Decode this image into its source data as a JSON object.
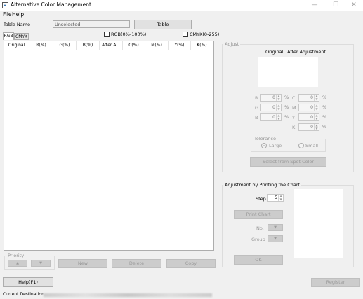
{
  "window": {
    "title": "Alternative Color Management",
    "controls": {
      "minimize": "—",
      "maximize": "☐",
      "close": "✕"
    }
  },
  "menu": {
    "file": "File",
    "help": "Help"
  },
  "table_name": {
    "label": "Table Name",
    "value": "Unselected",
    "table_button": "Table"
  },
  "tabs": {
    "rgb": "RGB",
    "cmyk": "CMYK"
  },
  "checkboxes": {
    "rgb": "RGB(0%-100%)",
    "cmyk": "CMYK(0-255)"
  },
  "table": {
    "columns": [
      "Original",
      "R(%)",
      "G(%)",
      "B(%)",
      "After A...",
      "C(%)",
      "M(%)",
      "Y(%)",
      "K(%)"
    ]
  },
  "priority": {
    "title": "Priority",
    "up": "▲",
    "down": "▼"
  },
  "list_buttons": {
    "new": "New",
    "delete": "Delete",
    "copy": "Copy"
  },
  "adjust": {
    "title": "Adjust",
    "original_label": "Original",
    "after_label": "After Adjustment",
    "rgb": [
      {
        "label": "R",
        "value": "0",
        "unit": "%"
      },
      {
        "label": "G",
        "value": "0",
        "unit": "%"
      },
      {
        "label": "B",
        "value": "0",
        "unit": "%"
      }
    ],
    "cmyk": [
      {
        "label": "C",
        "value": "0",
        "unit": "%"
      },
      {
        "label": "M",
        "value": "0",
        "unit": "%"
      },
      {
        "label": "Y",
        "value": "0",
        "unit": "%"
      },
      {
        "label": "K",
        "value": "0",
        "unit": "%"
      }
    ],
    "tolerance": {
      "title": "Tolerance",
      "large": "Large",
      "small": "Small",
      "selected": "Large"
    },
    "select_spot": "Select from Spot Color"
  },
  "chart": {
    "title": "Adjustment by Printing the Chart",
    "step_label": "Step",
    "step_value": "5",
    "print_chart": "Print Chart",
    "no_label": "No.",
    "group_label": "Group",
    "ok": "OK"
  },
  "footer": {
    "help": "Help(F1)",
    "register": "Register"
  },
  "status": {
    "label": "Current Destination"
  }
}
